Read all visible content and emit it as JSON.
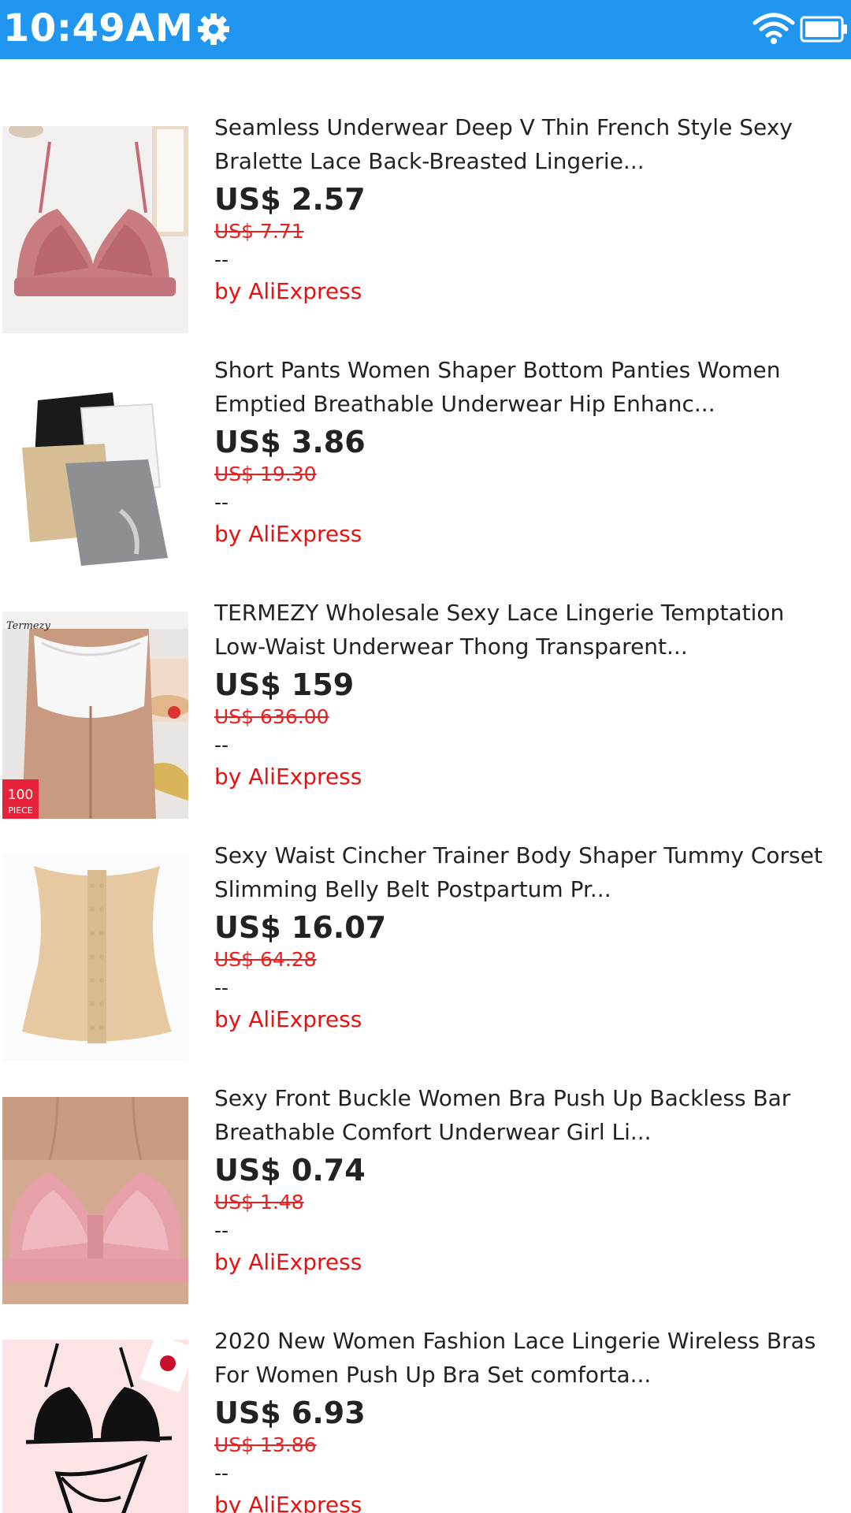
{
  "status_bar": {
    "time": "10:49AM",
    "bg_color": "#2196f0",
    "icons": [
      "gear-icon",
      "wifi-icon",
      "battery-icon"
    ]
  },
  "colors": {
    "price_text": "#222222",
    "original_price": "#e82020",
    "seller_text": "#e81010"
  },
  "products": [
    {
      "title": "Seamless Underwear Deep V Thin French Style Sexy\nBralette Lace Back-Breasted Lingerie...",
      "price": "US$ 2.57",
      "original_price": "US$ 7.71",
      "rating": "--",
      "seller": "by AliExpress",
      "image": "pink-lace-bralette-photo"
    },
    {
      "title": "Short Pants Women Shaper Bottom Panties Women\nEmptied Breathable Underwear Hip Enhanc...",
      "price": "US$ 3.86",
      "original_price": "US$ 19.30",
      "rating": "--",
      "seller": "by AliExpress",
      "image": "shaper-shorts-photo"
    },
    {
      "title": "TERMEZY Wholesale Sexy Lace Lingerie Temptation\nLow-Waist Underwear Thong Transparent...",
      "price": "US$ 159",
      "original_price": "US$ 636.00",
      "rating": "--",
      "seller": "by AliExpress",
      "image": "lace-thong-photo",
      "image_badge": [
        "100",
        "PIECE"
      ],
      "image_brand": "Termezy"
    },
    {
      "title": "Sexy Waist Cincher Trainer Body Shaper Tummy Corset\nSlimming Belly Belt Postpartum Pr...",
      "price": "US$ 16.07",
      "original_price": "US$ 64.28",
      "rating": "--",
      "seller": "by AliExpress",
      "image": "waist-cincher-photo"
    },
    {
      "title": "Sexy Front Buckle Women Bra Push Up Backless Bar\nBreathable Comfort Underwear Girl Li...",
      "price": "US$ 0.74",
      "original_price": "US$ 1.48",
      "rating": "--",
      "seller": "by AliExpress",
      "image": "pink-front-buckle-bra-photo"
    },
    {
      "title": "2020 New Women Fashion Lace Lingerie Wireless Bras\nFor Women Push Up Bra Set comforta...",
      "price": "US$ 6.93",
      "original_price": "US$ 13.86",
      "rating": "--",
      "seller": "by AliExpress",
      "image": "black-lace-lingerie-set-photo"
    }
  ]
}
